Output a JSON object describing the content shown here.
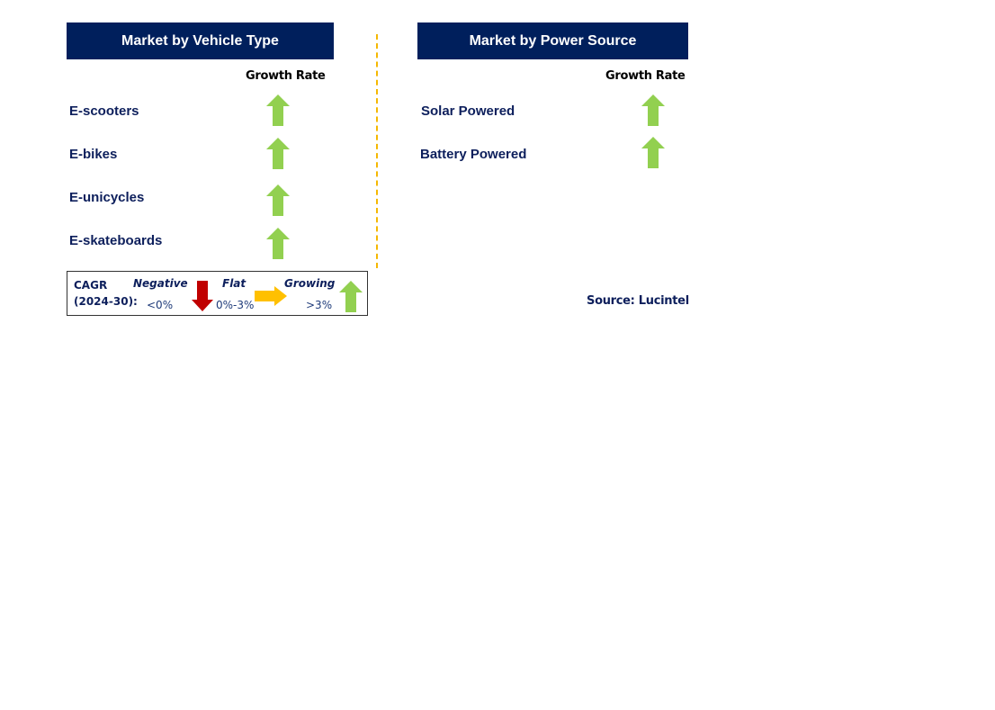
{
  "panels": [
    {
      "title": "Market by Vehicle Type",
      "column_header": "Growth Rate",
      "items": [
        {
          "label": "E-scooters",
          "trend": "growing"
        },
        {
          "label": "E-bikes",
          "trend": "growing"
        },
        {
          "label": "E-unicycles",
          "trend": "growing"
        },
        {
          "label": "E-skateboards",
          "trend": "growing"
        }
      ]
    },
    {
      "title": "Market by Power Source",
      "column_header": "Growth Rate",
      "items": [
        {
          "label": "Solar Powered",
          "trend": "growing"
        },
        {
          "label": "Battery Powered",
          "trend": "growing"
        }
      ]
    }
  ],
  "legend": {
    "cagr_label": "CAGR",
    "period": "(2024-30):",
    "negative": {
      "label": "Negative",
      "range": "<0%",
      "icon": "down-arrow-icon",
      "color": "#c00000"
    },
    "flat": {
      "label": "Flat",
      "range": "0%-3%",
      "icon": "right-arrow-icon",
      "color": "#ffc000"
    },
    "growing": {
      "label": "Growing",
      "range": ">3%",
      "icon": "up-arrow-icon",
      "color": "#92d050"
    }
  },
  "source": "Source: Lucintel",
  "colors": {
    "header_bg": "#001f5c",
    "label_text": "#0d1f5c",
    "divider": "#f5b800"
  }
}
